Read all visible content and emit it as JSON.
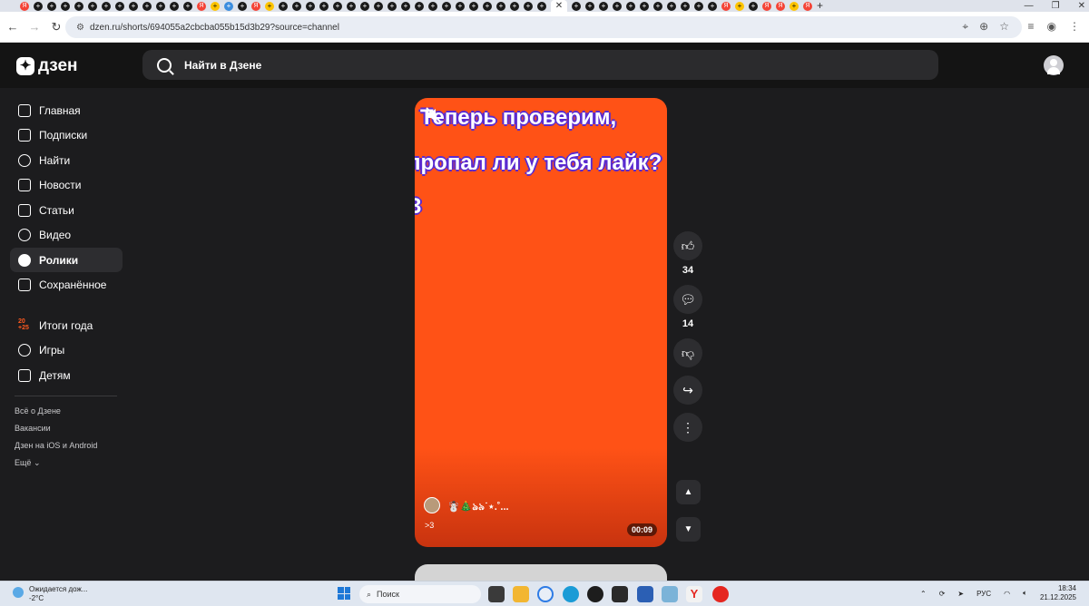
{
  "browser": {
    "url": "dzen.ru/shorts/694055a2cbcba055b15d3b29?source=channel",
    "tab_close": "✕",
    "new_tab": "+"
  },
  "header": {
    "logo_text": "дзен",
    "search_placeholder": "Найти в Дзене"
  },
  "sidebar": {
    "items": [
      {
        "label": "Главная",
        "icon": "home-icon"
      },
      {
        "label": "Подписки",
        "icon": "subscriptions-icon"
      },
      {
        "label": "Найти",
        "icon": "search-icon"
      },
      {
        "label": "Новости",
        "icon": "news-icon"
      },
      {
        "label": "Статьи",
        "icon": "articles-icon"
      },
      {
        "label": "Видео",
        "icon": "video-icon"
      },
      {
        "label": "Ролики",
        "icon": "shorts-icon",
        "active": true
      },
      {
        "label": "Сохранённое",
        "icon": "bookmark-icon"
      },
      {
        "label": "Итоги года",
        "icon": "year-2025-icon"
      },
      {
        "label": "Игры",
        "icon": "gamepad-icon"
      },
      {
        "label": "Детям",
        "icon": "kids-icon"
      }
    ],
    "year_badge_top": "20",
    "year_badge_bottom": "+25",
    "footer_links": [
      "Всё о Дзене",
      "Вакансии",
      "Дзен на iOS и Android",
      "Ещё"
    ]
  },
  "video": {
    "line1": "Теперь проверим,",
    "line2": "пропал ли у тебя лайк?",
    "line3": "3",
    "author": "☃️🎄ঌ৯˙⋆.˚...",
    "caption": ">3",
    "duration": "00:09"
  },
  "actions": {
    "likes": "34",
    "comments": "14"
  },
  "taskbar": {
    "weather_title": "Ожидается дож...",
    "weather_temp": "-2°C",
    "search_label": "Поиск",
    "lang": "РУС",
    "time": "18:34",
    "date": "21.12.2025"
  },
  "colors": {
    "video_bg": "#ff5216",
    "accent_year": "#ff5a1f",
    "page_bg": "#1c1c1e"
  }
}
